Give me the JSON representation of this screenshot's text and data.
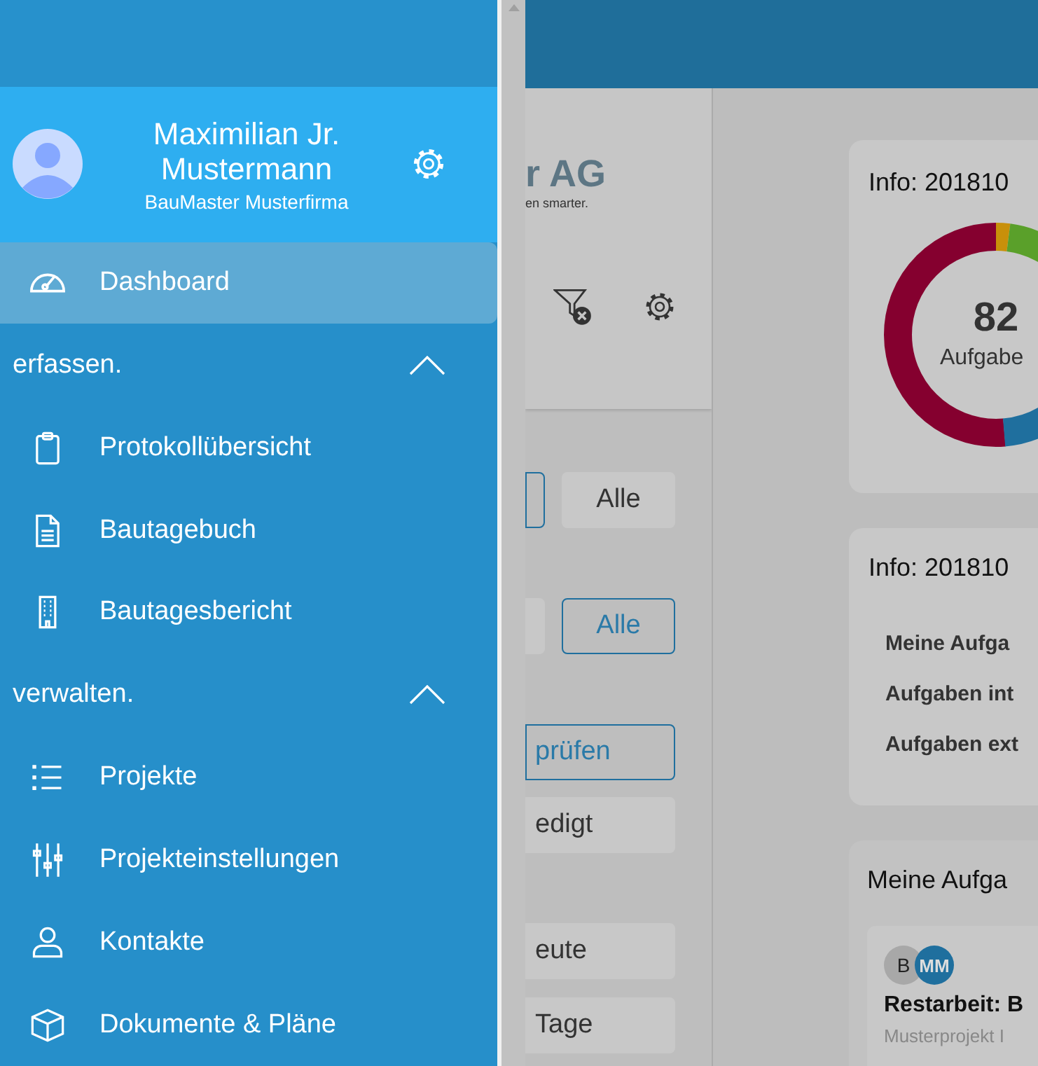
{
  "drawer": {
    "user": {
      "name": "Maximilian Jr. Mustermann",
      "company": "BauMaster Musterfirma"
    },
    "top_items": [
      {
        "label": "Dashboard",
        "selected": true
      }
    ],
    "sections": [
      {
        "title": "erfassen.",
        "expanded": true,
        "items": [
          {
            "label": "Protokollübersicht",
            "selected": false
          },
          {
            "label": "Bautagebuch",
            "selected": false
          },
          {
            "label": "Bautagesbericht",
            "selected": false
          }
        ]
      },
      {
        "title": "verwalten.",
        "expanded": true,
        "items": [
          {
            "label": "Projekte",
            "selected": false
          },
          {
            "label": "Projekteinstellungen",
            "selected": false
          },
          {
            "label": "Kontakte",
            "selected": false
          },
          {
            "label": "Dokumente & Pläne",
            "selected": false
          }
        ]
      }
    ]
  },
  "background": {
    "logo": "r AG",
    "tagline": "en smarter.",
    "filter_rows": [
      [
        {
          "kind": "outline"
        },
        {
          "kind": "filled",
          "label": "Alle"
        }
      ],
      [
        {
          "kind": "filled"
        },
        {
          "kind": "outline",
          "label": "Alle"
        }
      ],
      [
        {
          "kind": "outline",
          "label": "prüfen"
        }
      ],
      [
        {
          "kind": "filled",
          "label": "edigt"
        }
      ],
      [
        {
          "kind": "filled",
          "label": "eute"
        }
      ],
      [
        {
          "kind": "filled",
          "label": "Tage"
        }
      ]
    ],
    "chart_card": {
      "title": "Info: 201810",
      "total": "82",
      "caption": "Aufgabe"
    },
    "info_card": {
      "title": "Info: 201810",
      "rows": [
        "Meine Aufga",
        "Aufgaben int",
        "Aufgaben ext"
      ]
    },
    "tasks_card": {
      "title": "Meine Aufga",
      "task": {
        "avatars": [
          "B",
          "MM"
        ],
        "title": "Restarbeit: B",
        "project": "Musterprojekt I"
      }
    }
  }
}
